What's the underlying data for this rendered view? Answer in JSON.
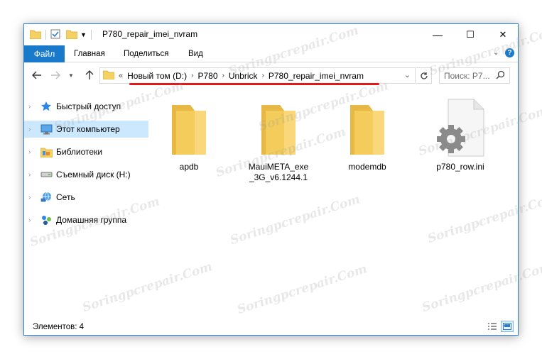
{
  "window": {
    "title": "P780_repair_imei_nvram",
    "controls": {
      "minimize": "—",
      "maximize": "☐",
      "close": "✕"
    }
  },
  "ribbon": {
    "tabs": [
      {
        "label": "Файл"
      },
      {
        "label": "Главная"
      },
      {
        "label": "Поделиться"
      },
      {
        "label": "Вид"
      }
    ]
  },
  "address": {
    "overflow": "«",
    "crumbs": [
      "Новый том (D:)",
      "P780",
      "Unbrick",
      "P780_repair_imei_nvram"
    ],
    "separator": "›"
  },
  "search": {
    "placeholder": "Поиск: P7..."
  },
  "nav": {
    "items": [
      {
        "label": "Быстрый доступ",
        "icon": "star-icon"
      },
      {
        "label": "Этот компьютер",
        "icon": "computer-icon",
        "selected": true
      },
      {
        "label": "Библиотеки",
        "icon": "libraries-icon"
      },
      {
        "label": "Съемный диск (H:)",
        "icon": "removable-drive-icon"
      },
      {
        "label": "Сеть",
        "icon": "network-icon"
      },
      {
        "label": "Домашняя группа",
        "icon": "homegroup-icon"
      }
    ]
  },
  "files": [
    {
      "name": "apdb",
      "type": "folder"
    },
    {
      "name": "MauiMETA_exe_3G_v6.1244.1",
      "type": "folder"
    },
    {
      "name": "modemdb",
      "type": "folder"
    },
    {
      "name": "p780_row.ini",
      "type": "ini"
    }
  ],
  "status": {
    "items_count": "Элементов: 4"
  },
  "watermark": "Soringpcrepair.Com",
  "colors": {
    "accent": "#1979ca",
    "selection": "#cce8ff",
    "highlight_line": "#e31919",
    "folder": "#f4d162"
  }
}
